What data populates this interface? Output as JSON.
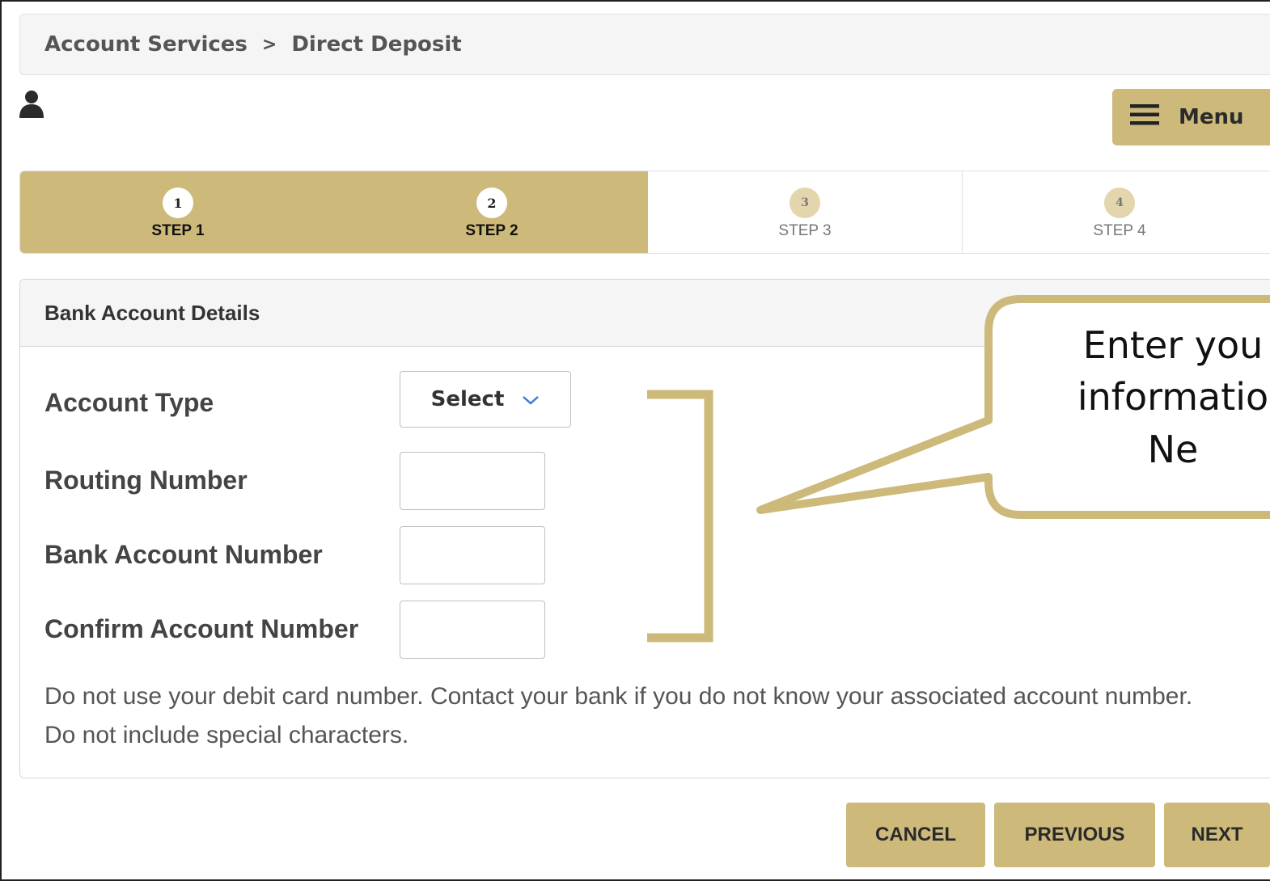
{
  "breadcrumb": {
    "parent": "Account Services",
    "separator": ">",
    "current": "Direct Deposit"
  },
  "header": {
    "user_icon": "user-icon",
    "menu_label": "Menu",
    "menu_icon": "hamburger-icon"
  },
  "steps": [
    {
      "number": "1",
      "label": "STEP 1",
      "status": "complete"
    },
    {
      "number": "2",
      "label": "STEP 2",
      "status": "complete"
    },
    {
      "number": "3",
      "label": "STEP 3",
      "status": "pending"
    },
    {
      "number": "4",
      "label": "STEP 4",
      "status": "pending"
    }
  ],
  "panel": {
    "title": "Bank Account Details",
    "fields": {
      "account_type": {
        "label": "Account Type",
        "value": "Select",
        "icon": "chevron-down-icon"
      },
      "routing_number": {
        "label": "Routing Number",
        "value": ""
      },
      "bank_account_number": {
        "label": "Bank Account Number",
        "value": ""
      },
      "confirm_account_number": {
        "label": "Confirm Account Number",
        "value": ""
      }
    },
    "note": "Do not use your debit card number. Contact your bank if you do not know your associated account number. Do not include special characters."
  },
  "actions": {
    "cancel": "CANCEL",
    "previous": "PREVIOUS",
    "next": "NEXT"
  },
  "callout": {
    "lines": [
      "Enter you",
      "informatio",
      "Ne"
    ]
  },
  "colors": {
    "accent": "#cdb97a",
    "panel_bg": "#f5f5f5",
    "border": "#d6d6d6",
    "chevron": "#3a7bd5"
  }
}
